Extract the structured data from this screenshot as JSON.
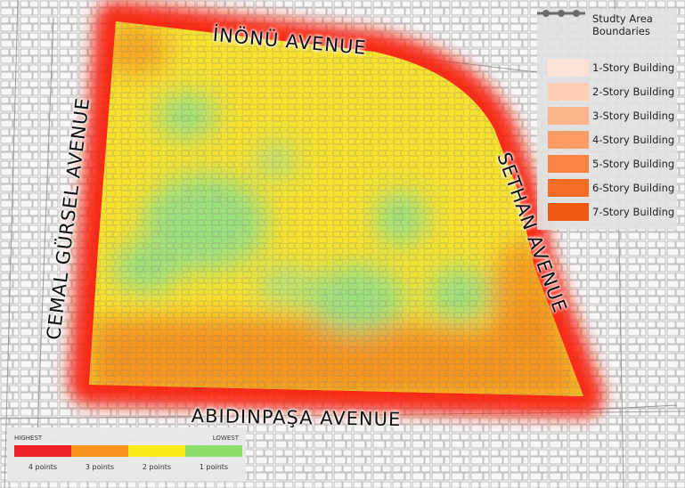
{
  "streets": {
    "north": "İNÖNÜ AVENUE",
    "west": "CEMAL GÜRSEL AVENUE",
    "east": "SETHAN AVENUE",
    "south": "ABIDINPAŞA AVENUE"
  },
  "legend": {
    "boundary_label": "Studty Area Boundaries",
    "buildings": [
      {
        "label": "1-Story Building",
        "color": "#fde3d5"
      },
      {
        "label": "2-Story Building",
        "color": "#fccfb3"
      },
      {
        "label": "3-Story Building",
        "color": "#fbb58c"
      },
      {
        "label": "4-Story Building",
        "color": "#f99c66"
      },
      {
        "label": "5-Story Building",
        "color": "#f78441"
      },
      {
        "label": "6-Story Building",
        "color": "#f56c22"
      },
      {
        "label": "7-Story Building",
        "color": "#ef5a10"
      }
    ]
  },
  "scale": {
    "high_label": "HIGHEST",
    "low_label": "LOWEST",
    "classes": [
      {
        "label": "4 points",
        "color": "#f0232a"
      },
      {
        "label": "3 points",
        "color": "#f7931e"
      },
      {
        "label": "2 points",
        "color": "#f8ec1b"
      },
      {
        "label": "1 points",
        "color": "#8edd6f"
      }
    ]
  }
}
